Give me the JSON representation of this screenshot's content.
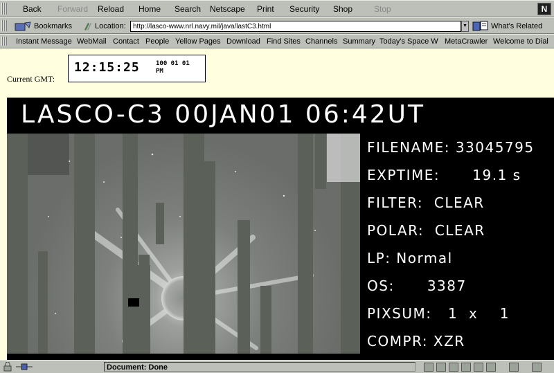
{
  "navbar": {
    "buttons": [
      {
        "label": "Back",
        "enabled": true
      },
      {
        "label": "Forward",
        "enabled": false
      },
      {
        "label": "Reload",
        "enabled": true
      },
      {
        "label": "Home",
        "enabled": true
      },
      {
        "label": "Search",
        "enabled": true
      },
      {
        "label": "Netscape",
        "enabled": true
      },
      {
        "label": "Print",
        "enabled": true
      },
      {
        "label": "Security",
        "enabled": true
      },
      {
        "label": "Shop",
        "enabled": true
      },
      {
        "label": "Stop",
        "enabled": false
      }
    ],
    "logo": "N"
  },
  "location_bar": {
    "bookmarks_label": "Bookmarks",
    "location_label": "Location:",
    "url": "http://lasco-www.nrl.navy.mil/java/lastC3.html",
    "whats_related": "What's Related"
  },
  "personal_toolbar": {
    "items": [
      "Instant Message",
      "WebMail",
      "Contact",
      "People",
      "Yellow Pages",
      "Download",
      "Find Sites",
      "Channels",
      "Summary",
      "Today's Space W",
      "MetaCrawler",
      "Welcome to Dial"
    ]
  },
  "page": {
    "gmt_label": "Current GMT:",
    "clock_time": "12:15:25",
    "clock_date": "100 01 01",
    "clock_ampm": "PM",
    "lasco_title": "LASCO-C3 00JAN01 06:42UT",
    "meta_lines": [
      "FILENAME: 33045795",
      "EXPTIME:      19.1 s",
      "FILTER:  CLEAR",
      "POLAR:  CLEAR",
      "LP: Normal",
      "OS:      3387",
      "PIXSUM:   1  x    1",
      "COMPR: XZR"
    ]
  },
  "status": {
    "text": "Document: Done"
  },
  "colors": {
    "toolbar": "#bcc0b8",
    "page_bg": "#ffffe0",
    "image_bg": "#000000",
    "image_gray": "#5b6159"
  }
}
